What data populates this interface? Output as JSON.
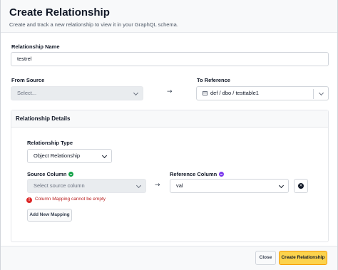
{
  "header": {
    "title": "Create Relationship",
    "subtitle": "Create and track a new relationship to view it in your GraphQL schema."
  },
  "relationship_name": {
    "label": "Relationship Name",
    "value": "testrel"
  },
  "from_source": {
    "label": "From Source",
    "placeholder": "Select..."
  },
  "to_reference": {
    "label": "To Reference",
    "value": "def / dbo / testtable1"
  },
  "details": {
    "title": "Relationship Details",
    "type_label": "Relationship Type",
    "type_value": "Object Relationship",
    "source_column_label": "Source Column",
    "source_column_placeholder": "Select source column",
    "reference_column_label": "Reference Column",
    "reference_column_value": "val",
    "error": "Column Mapping cannot be empty",
    "add_mapping": "Add New Mapping"
  },
  "footer": {
    "close": "Close",
    "create": "Create Relationship"
  },
  "icons": {
    "arrow": "arrow-right-icon",
    "source_dot": "green-arrow-circle-icon",
    "reference_dot": "purple-arrow-circle-icon",
    "error": "exclamation-circle-icon",
    "remove": "close-circle-icon",
    "table": "table-icon"
  },
  "colors": {
    "primary_button": "#fcd34d",
    "error": "#dc2626",
    "source_dot": "#16a34a",
    "reference_dot": "#7c3aed"
  }
}
